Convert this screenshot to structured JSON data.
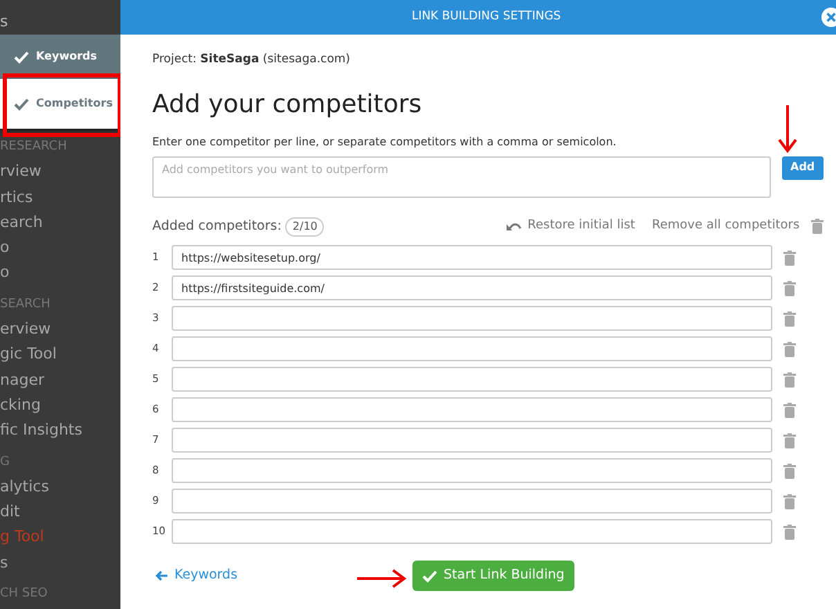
{
  "sidebar": {
    "heading": "s",
    "items": [
      {
        "label": "RESEARCH",
        "kind": "section",
        "selected": false
      },
      {
        "label": "rview",
        "kind": "link",
        "selected": false
      },
      {
        "label": "rtics",
        "kind": "link",
        "selected": false
      },
      {
        "label": "earch",
        "kind": "link",
        "selected": false
      },
      {
        "label": "o",
        "kind": "link",
        "selected": false
      },
      {
        "label": "o",
        "kind": "link",
        "selected": false
      },
      {
        "label": "SEARCH",
        "kind": "section",
        "selected": false
      },
      {
        "label": "erview",
        "kind": "link",
        "selected": false
      },
      {
        "label": "gic Tool",
        "kind": "link",
        "selected": false
      },
      {
        "label": "nager",
        "kind": "link",
        "selected": false
      },
      {
        "label": "cking",
        "kind": "link",
        "selected": false
      },
      {
        "label": "fic Insights",
        "kind": "link",
        "selected": false
      },
      {
        "label": "G",
        "kind": "section",
        "selected": false
      },
      {
        "label": "alytics",
        "kind": "link",
        "selected": false
      },
      {
        "label": "dit",
        "kind": "link",
        "selected": false
      },
      {
        "label": "g Tool",
        "kind": "link",
        "selected": true
      },
      {
        "label": "s",
        "kind": "link",
        "selected": false
      },
      {
        "label": "CH SEO",
        "kind": "section",
        "selected": false
      }
    ]
  },
  "steps": [
    {
      "label": "Keywords",
      "selected": false
    },
    {
      "label": "Competitors",
      "selected": true
    }
  ],
  "modal": {
    "title": "LINK BUILDING SETTINGS",
    "project": "Project: **SiteSaga** (sitesaga.com)",
    "heading": "Add your competitors",
    "description": "Enter one competitor per line, or separate competitors with a comma or semicolon.",
    "input": {
      "placeholder": "Add competitors you want to outperform"
    },
    "add_button": "Add",
    "added_label": "Added competitors:",
    "count": "2/10",
    "restore": "Restore initial list",
    "remove_all": "Remove all competitors",
    "rows": [
      {
        "number": "1",
        "value": "https://websitesetup.org/"
      },
      {
        "number": "2",
        "value": "https://firstsiteguide.com/"
      },
      {
        "number": "3",
        "value": ""
      },
      {
        "number": "4",
        "value": ""
      },
      {
        "number": "5",
        "value": ""
      },
      {
        "number": "6",
        "value": ""
      },
      {
        "number": "7",
        "value": ""
      },
      {
        "number": "8",
        "value": ""
      },
      {
        "number": "9",
        "value": ""
      },
      {
        "number": "10",
        "value": ""
      }
    ],
    "back": "Keywords",
    "start": "Start Link Building"
  }
}
